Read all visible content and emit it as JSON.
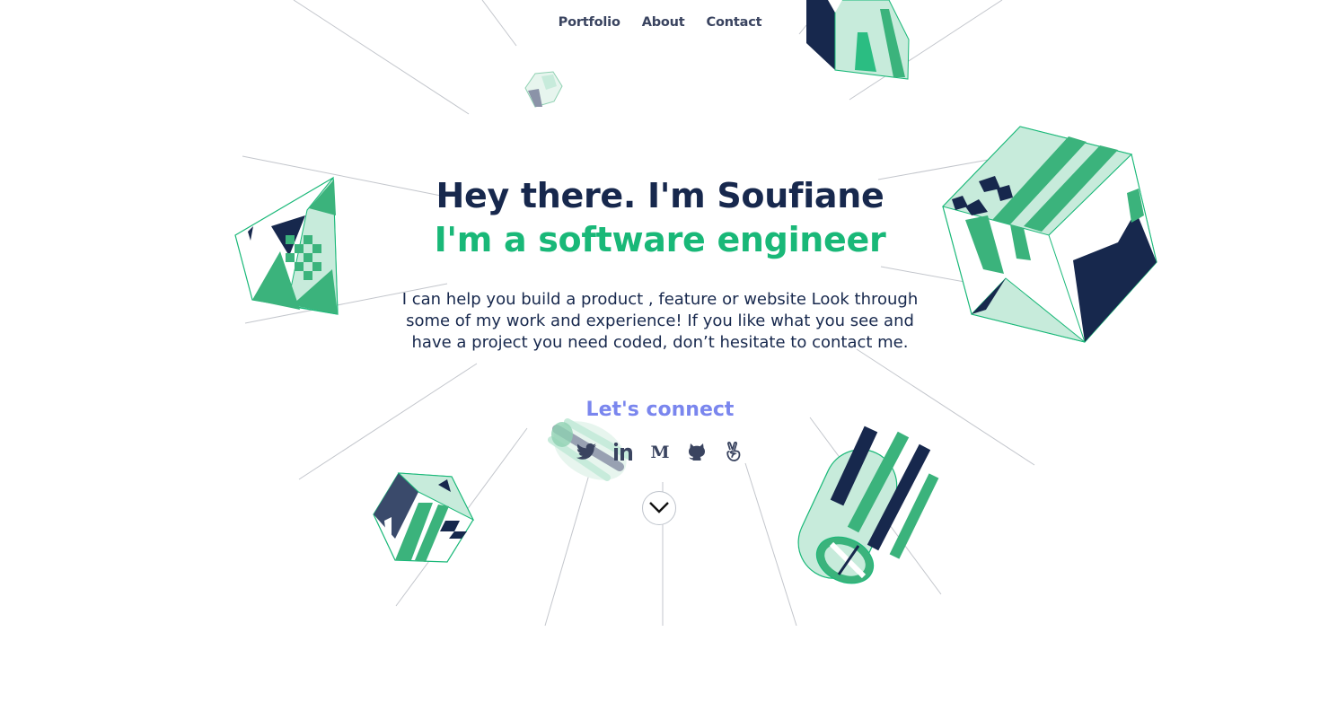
{
  "nav": {
    "portfolio": "Portfolio",
    "about": "About",
    "contact": "Contact"
  },
  "hero": {
    "greeting": "Hey there. I'm Soufiane",
    "role": "I'm a software engineer",
    "intro": "I can help you build a product , feature or website Look through some of my work and experience! If you like what you see and have a project you need coded, don’t hesitate to contact me."
  },
  "connect": {
    "heading": "Let's connect",
    "links": [
      "twitter-icon",
      "linkedin-icon",
      "medium-icon",
      "github-icon",
      "angellist-icon"
    ]
  },
  "colors": {
    "navy": "#17284d",
    "green": "#19b878",
    "mint": "#c7ebdb",
    "accent": "#7a86ee"
  }
}
